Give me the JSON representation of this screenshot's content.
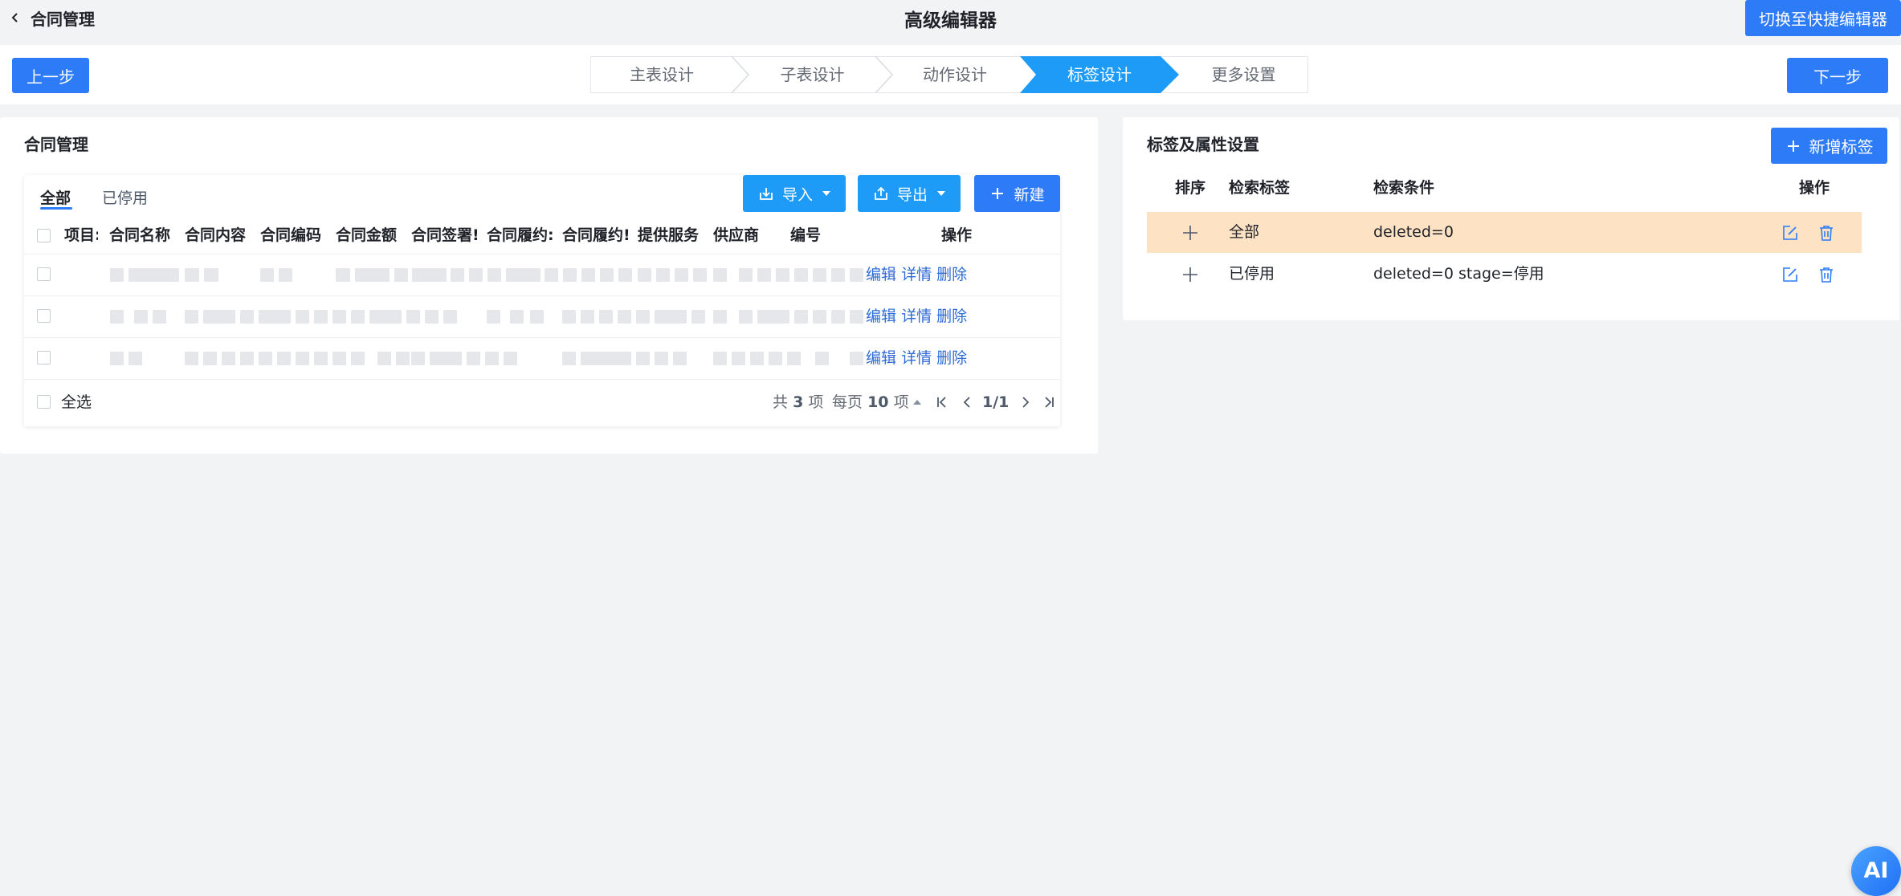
{
  "topbar": {
    "back_label": "合同管理",
    "center_title": "高级编辑器",
    "switch_label": "切换至快捷编辑器"
  },
  "stepsbar": {
    "prev_label": "上一步",
    "next_label": "下一步",
    "steps": [
      {
        "label": "主表设计",
        "active": false
      },
      {
        "label": "子表设计",
        "active": false
      },
      {
        "label": "动作设计",
        "active": false
      },
      {
        "label": "标签设计",
        "active": true
      },
      {
        "label": "更多设置",
        "active": false
      }
    ]
  },
  "left_card": {
    "title": "合同管理",
    "tabs": [
      {
        "label": "全部",
        "active": true
      },
      {
        "label": "已停用",
        "active": false
      }
    ],
    "toolbar": {
      "import_label": "导入",
      "export_label": "导出",
      "new_label": "新建"
    },
    "columns": [
      "项目:",
      "合同名称",
      "合同内容",
      "合同编码",
      "合同金额",
      "合同签署!",
      "合同履约:",
      "合同履约!",
      "提供服务",
      "供应商",
      "编号",
      "操作"
    ],
    "row_actions": {
      "edit": "编辑",
      "detail": "详情",
      "delete": "删除"
    },
    "row_count": 3,
    "footer": {
      "select_all": "全选",
      "total_prefix": "共",
      "total": "3",
      "total_suffix": "项",
      "per_page_prefix": "每页",
      "per_page": "10",
      "per_page_suffix": "项",
      "page": "1/1"
    }
  },
  "right_card": {
    "title": "标签及属性设置",
    "add_label": "新增标签",
    "headers": {
      "order": "排序",
      "tag": "检索标签",
      "condition": "检索条件",
      "action": "操作"
    },
    "rows": [
      {
        "tag": "全部",
        "condition": "deleted=0",
        "selected": true
      },
      {
        "tag": "已停用",
        "condition": "deleted=0 stage=停用",
        "selected": false
      }
    ]
  },
  "ai_label": "AI",
  "colors": {
    "primary": "#2d7bf6",
    "primary_light": "#1e9bf6",
    "link": "#2d6bd6",
    "selected_row": "#fde2c4",
    "background": "#f2f3f5"
  }
}
